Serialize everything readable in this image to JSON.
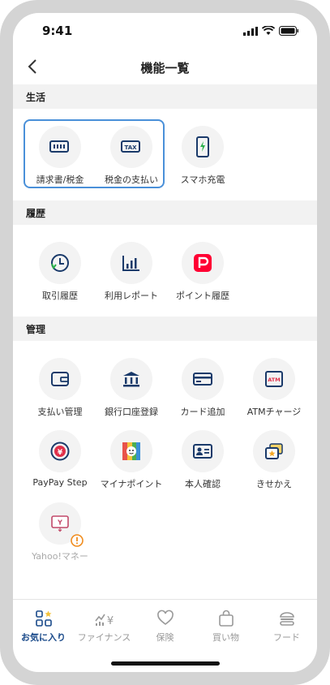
{
  "status": {
    "time": "9:41"
  },
  "header": {
    "title": "機能一覧"
  },
  "sections": {
    "life": {
      "title": "生活",
      "items": [
        "請求書/税金",
        "税金の支払い",
        "スマホ充電"
      ]
    },
    "history": {
      "title": "履歴",
      "items": [
        "取引履歴",
        "利用レポート",
        "ポイント履歴"
      ]
    },
    "manage": {
      "title": "管理",
      "items": [
        "支払い管理",
        "銀行口座登録",
        "カード追加",
        "ATMチャージ",
        "PayPay Step",
        "マイナポイント",
        "本人確認",
        "きせかえ",
        "Yahoo!マネー"
      ]
    }
  },
  "tabs": [
    {
      "label": "お気に入り",
      "active": true
    },
    {
      "label": "ファイナンス",
      "active": false
    },
    {
      "label": "保険",
      "active": false
    },
    {
      "label": "買い物",
      "active": false
    },
    {
      "label": "フード",
      "active": false
    }
  ],
  "colors": {
    "accent": "#1a4a8a",
    "highlight": "#4a90d9",
    "paypay_red": "#ff0033",
    "warning": "#f08c1e"
  }
}
